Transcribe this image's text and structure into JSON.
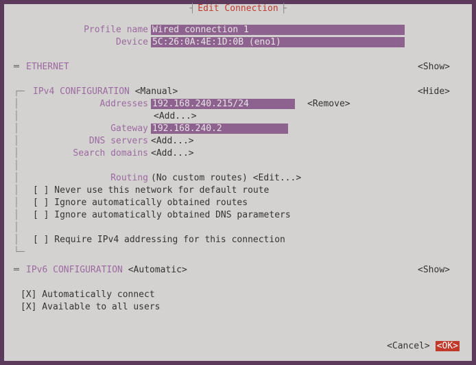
{
  "title": "Edit Connection",
  "profile": {
    "name_label": "Profile name",
    "name_value": "Wired connection 1",
    "device_label": "Device",
    "device_value": "5C:26:0A:4E:1D:0B (eno1)"
  },
  "ethernet": {
    "header": "ETHERNET",
    "action": "<Show>"
  },
  "ipv4": {
    "header": "IPv4 CONFIGURATION",
    "mode": "<Manual>",
    "action": "<Hide>",
    "addresses_label": "Addresses",
    "address_value": "192.168.240.215/24",
    "remove": "<Remove>",
    "add": "<Add...>",
    "gateway_label": "Gateway",
    "gateway_value": "192.168.240.2",
    "dns_label": "DNS servers",
    "search_label": "Search domains",
    "routing_label": "Routing",
    "routing_text": "(No custom routes)",
    "routing_edit": "<Edit...>",
    "cb1": "[ ] Never use this network for default route",
    "cb2": "[ ] Ignore automatically obtained routes",
    "cb3": "[ ] Ignore automatically obtained DNS parameters",
    "cb4": "[ ] Require IPv4 addressing for this connection"
  },
  "ipv6": {
    "header": "IPv6 CONFIGURATION",
    "mode": "<Automatic>",
    "action": "<Show>"
  },
  "auto_connect": "[X] Automatically connect",
  "all_users": "[X] Available to all users",
  "cancel": "<Cancel>",
  "ok": "<OK>"
}
